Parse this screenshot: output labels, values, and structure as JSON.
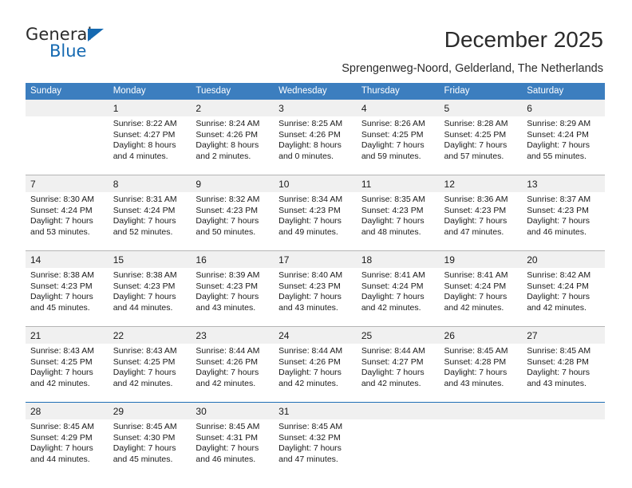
{
  "brand": {
    "name_part1": "General",
    "name_part2": "Blue",
    "triangle_color": "#1569b1"
  },
  "header": {
    "title": "December 2025",
    "subtitle": "Sprengenweg-Noord, Gelderland, The Netherlands"
  },
  "colors": {
    "header_bar": "#3c7ebf",
    "daynum_band": "#f0f0f0",
    "separator": "#b4b4b4",
    "separator_accent": "#1f6eb5",
    "brand_blue": "#1569b1"
  },
  "weekdays": [
    "Sunday",
    "Monday",
    "Tuesday",
    "Wednesday",
    "Thursday",
    "Friday",
    "Saturday"
  ],
  "weeks": [
    {
      "separator_style": "none",
      "days": [
        {
          "day": "",
          "empty": true
        },
        {
          "day": "1",
          "sunrise": "Sunrise: 8:22 AM",
          "sunset": "Sunset: 4:27 PM",
          "daylight_line1": "Daylight: 8 hours",
          "daylight_line2": "and 4 minutes."
        },
        {
          "day": "2",
          "sunrise": "Sunrise: 8:24 AM",
          "sunset": "Sunset: 4:26 PM",
          "daylight_line1": "Daylight: 8 hours",
          "daylight_line2": "and 2 minutes."
        },
        {
          "day": "3",
          "sunrise": "Sunrise: 8:25 AM",
          "sunset": "Sunset: 4:26 PM",
          "daylight_line1": "Daylight: 8 hours",
          "daylight_line2": "and 0 minutes."
        },
        {
          "day": "4",
          "sunrise": "Sunrise: 8:26 AM",
          "sunset": "Sunset: 4:25 PM",
          "daylight_line1": "Daylight: 7 hours",
          "daylight_line2": "and 59 minutes."
        },
        {
          "day": "5",
          "sunrise": "Sunrise: 8:28 AM",
          "sunset": "Sunset: 4:25 PM",
          "daylight_line1": "Daylight: 7 hours",
          "daylight_line2": "and 57 minutes."
        },
        {
          "day": "6",
          "sunrise": "Sunrise: 8:29 AM",
          "sunset": "Sunset: 4:24 PM",
          "daylight_line1": "Daylight: 7 hours",
          "daylight_line2": "and 55 minutes."
        }
      ]
    },
    {
      "separator_style": "gray",
      "days": [
        {
          "day": "7",
          "sunrise": "Sunrise: 8:30 AM",
          "sunset": "Sunset: 4:24 PM",
          "daylight_line1": "Daylight: 7 hours",
          "daylight_line2": "and 53 minutes."
        },
        {
          "day": "8",
          "sunrise": "Sunrise: 8:31 AM",
          "sunset": "Sunset: 4:24 PM",
          "daylight_line1": "Daylight: 7 hours",
          "daylight_line2": "and 52 minutes."
        },
        {
          "day": "9",
          "sunrise": "Sunrise: 8:32 AM",
          "sunset": "Sunset: 4:23 PM",
          "daylight_line1": "Daylight: 7 hours",
          "daylight_line2": "and 50 minutes."
        },
        {
          "day": "10",
          "sunrise": "Sunrise: 8:34 AM",
          "sunset": "Sunset: 4:23 PM",
          "daylight_line1": "Daylight: 7 hours",
          "daylight_line2": "and 49 minutes."
        },
        {
          "day": "11",
          "sunrise": "Sunrise: 8:35 AM",
          "sunset": "Sunset: 4:23 PM",
          "daylight_line1": "Daylight: 7 hours",
          "daylight_line2": "and 48 minutes."
        },
        {
          "day": "12",
          "sunrise": "Sunrise: 8:36 AM",
          "sunset": "Sunset: 4:23 PM",
          "daylight_line1": "Daylight: 7 hours",
          "daylight_line2": "and 47 minutes."
        },
        {
          "day": "13",
          "sunrise": "Sunrise: 8:37 AM",
          "sunset": "Sunset: 4:23 PM",
          "daylight_line1": "Daylight: 7 hours",
          "daylight_line2": "and 46 minutes."
        }
      ]
    },
    {
      "separator_style": "gray",
      "days": [
        {
          "day": "14",
          "sunrise": "Sunrise: 8:38 AM",
          "sunset": "Sunset: 4:23 PM",
          "daylight_line1": "Daylight: 7 hours",
          "daylight_line2": "and 45 minutes."
        },
        {
          "day": "15",
          "sunrise": "Sunrise: 8:38 AM",
          "sunset": "Sunset: 4:23 PM",
          "daylight_line1": "Daylight: 7 hours",
          "daylight_line2": "and 44 minutes."
        },
        {
          "day": "16",
          "sunrise": "Sunrise: 8:39 AM",
          "sunset": "Sunset: 4:23 PM",
          "daylight_line1": "Daylight: 7 hours",
          "daylight_line2": "and 43 minutes."
        },
        {
          "day": "17",
          "sunrise": "Sunrise: 8:40 AM",
          "sunset": "Sunset: 4:23 PM",
          "daylight_line1": "Daylight: 7 hours",
          "daylight_line2": "and 43 minutes."
        },
        {
          "day": "18",
          "sunrise": "Sunrise: 8:41 AM",
          "sunset": "Sunset: 4:24 PM",
          "daylight_line1": "Daylight: 7 hours",
          "daylight_line2": "and 42 minutes."
        },
        {
          "day": "19",
          "sunrise": "Sunrise: 8:41 AM",
          "sunset": "Sunset: 4:24 PM",
          "daylight_line1": "Daylight: 7 hours",
          "daylight_line2": "and 42 minutes."
        },
        {
          "day": "20",
          "sunrise": "Sunrise: 8:42 AM",
          "sunset": "Sunset: 4:24 PM",
          "daylight_line1": "Daylight: 7 hours",
          "daylight_line2": "and 42 minutes."
        }
      ]
    },
    {
      "separator_style": "gray",
      "days": [
        {
          "day": "21",
          "sunrise": "Sunrise: 8:43 AM",
          "sunset": "Sunset: 4:25 PM",
          "daylight_line1": "Daylight: 7 hours",
          "daylight_line2": "and 42 minutes."
        },
        {
          "day": "22",
          "sunrise": "Sunrise: 8:43 AM",
          "sunset": "Sunset: 4:25 PM",
          "daylight_line1": "Daylight: 7 hours",
          "daylight_line2": "and 42 minutes."
        },
        {
          "day": "23",
          "sunrise": "Sunrise: 8:44 AM",
          "sunset": "Sunset: 4:26 PM",
          "daylight_line1": "Daylight: 7 hours",
          "daylight_line2": "and 42 minutes."
        },
        {
          "day": "24",
          "sunrise": "Sunrise: 8:44 AM",
          "sunset": "Sunset: 4:26 PM",
          "daylight_line1": "Daylight: 7 hours",
          "daylight_line2": "and 42 minutes."
        },
        {
          "day": "25",
          "sunrise": "Sunrise: 8:44 AM",
          "sunset": "Sunset: 4:27 PM",
          "daylight_line1": "Daylight: 7 hours",
          "daylight_line2": "and 42 minutes."
        },
        {
          "day": "26",
          "sunrise": "Sunrise: 8:45 AM",
          "sunset": "Sunset: 4:28 PM",
          "daylight_line1": "Daylight: 7 hours",
          "daylight_line2": "and 43 minutes."
        },
        {
          "day": "27",
          "sunrise": "Sunrise: 8:45 AM",
          "sunset": "Sunset: 4:28 PM",
          "daylight_line1": "Daylight: 7 hours",
          "daylight_line2": "and 43 minutes."
        }
      ]
    },
    {
      "separator_style": "blue",
      "days": [
        {
          "day": "28",
          "sunrise": "Sunrise: 8:45 AM",
          "sunset": "Sunset: 4:29 PM",
          "daylight_line1": "Daylight: 7 hours",
          "daylight_line2": "and 44 minutes."
        },
        {
          "day": "29",
          "sunrise": "Sunrise: 8:45 AM",
          "sunset": "Sunset: 4:30 PM",
          "daylight_line1": "Daylight: 7 hours",
          "daylight_line2": "and 45 minutes."
        },
        {
          "day": "30",
          "sunrise": "Sunrise: 8:45 AM",
          "sunset": "Sunset: 4:31 PM",
          "daylight_line1": "Daylight: 7 hours",
          "daylight_line2": "and 46 minutes."
        },
        {
          "day": "31",
          "sunrise": "Sunrise: 8:45 AM",
          "sunset": "Sunset: 4:32 PM",
          "daylight_line1": "Daylight: 7 hours",
          "daylight_line2": "and 47 minutes."
        },
        {
          "day": "",
          "empty": true
        },
        {
          "day": "",
          "empty": true
        },
        {
          "day": "",
          "empty": true
        }
      ]
    }
  ]
}
